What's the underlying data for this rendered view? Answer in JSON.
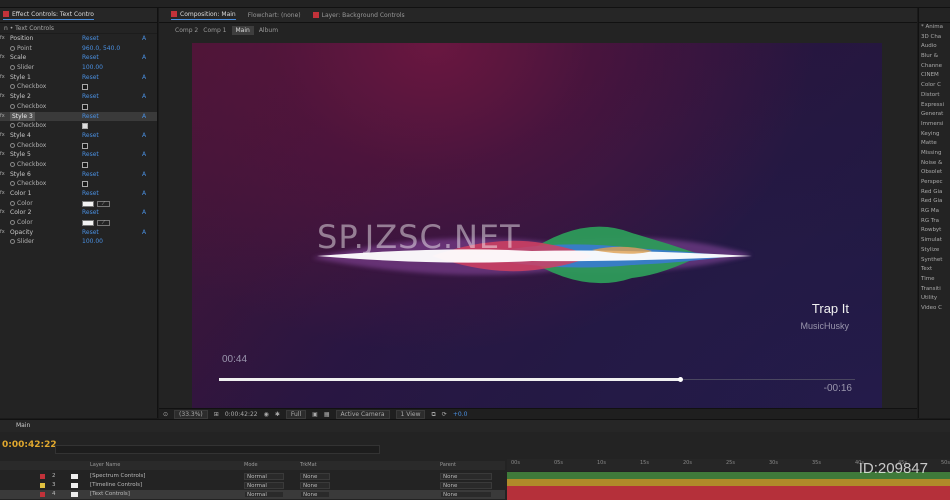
{
  "effect_controls": {
    "tab_label": "Effect Controls: Text Contro",
    "subtitle": "n • Text Controls",
    "rows": [
      {
        "name": "Position",
        "type": "header",
        "reset": "Reset",
        "about": "A"
      },
      {
        "name": "Point",
        "type": "point",
        "value": "960.0, 540.0"
      },
      {
        "name": "Scale",
        "type": "header",
        "reset": "Reset",
        "about": "A"
      },
      {
        "name": "Slider",
        "type": "slider",
        "value": "100.00"
      },
      {
        "name": "Style 1",
        "type": "header",
        "reset": "Reset",
        "about": "A"
      },
      {
        "name": "Checkbox",
        "type": "checkbox",
        "checked": false
      },
      {
        "name": "Style 2",
        "type": "header",
        "reset": "Reset",
        "about": "A"
      },
      {
        "name": "Checkbox",
        "type": "checkbox",
        "checked": false
      },
      {
        "name": "Style 3",
        "type": "header",
        "reset": "Reset",
        "about": "A",
        "selected": true
      },
      {
        "name": "Checkbox",
        "type": "checkbox",
        "checked": true
      },
      {
        "name": "Style 4",
        "type": "header",
        "reset": "Reset",
        "about": "A"
      },
      {
        "name": "Checkbox",
        "type": "checkbox",
        "checked": false
      },
      {
        "name": "Style 5",
        "type": "header",
        "reset": "Reset",
        "about": "A"
      },
      {
        "name": "Checkbox",
        "type": "checkbox",
        "checked": false
      },
      {
        "name": "Style 6",
        "type": "header",
        "reset": "Reset",
        "about": "A"
      },
      {
        "name": "Checkbox",
        "type": "checkbox",
        "checked": false
      },
      {
        "name": "Color 1",
        "type": "header",
        "reset": "Reset",
        "about": "A"
      },
      {
        "name": "Color",
        "type": "color"
      },
      {
        "name": "Color 2",
        "type": "header",
        "reset": "Reset",
        "about": "A"
      },
      {
        "name": "Color",
        "type": "color"
      },
      {
        "name": "Opacity",
        "type": "header",
        "reset": "Reset",
        "about": "A"
      },
      {
        "name": "Slider",
        "type": "slider",
        "value": "100.00"
      }
    ]
  },
  "composition": {
    "tab_label": "Composition: Main",
    "tab_flowchart": "Flowchart: (none)",
    "tab_layer": "Layer: Background Controls",
    "breadcrumbs": [
      "Comp 2",
      "Comp 1",
      "Main",
      "Album"
    ],
    "active_crumb": "Main",
    "song_title": "Trap It",
    "song_artist": "MusicHusky",
    "time_elapsed": "00:44",
    "time_remaining": "-00:16",
    "progress": 0.725,
    "watermark": "SP.JZSC.NET",
    "footer": {
      "zoom": "(33.3%)",
      "timecode": "0:00:42:22",
      "resolution": "Full",
      "camera": "Active Camera",
      "view": "1 View",
      "exposure": "+0.0"
    }
  },
  "effects_presets": {
    "items": [
      "* Anima",
      "3D Cha",
      "Audio",
      "Blur &",
      "Channe",
      "CINEM",
      "Color C",
      "Distort",
      "Expressi",
      "Generat",
      "Immersi",
      "Keying",
      "Matte",
      "Missing",
      "Noise &",
      "Obsolet",
      "Perspec",
      "Red Gia",
      "Red Gia",
      "RG Ma",
      "RG Tra",
      "Rowbyt",
      "Simulat",
      "Stylize",
      "Synthet",
      "Text",
      "Time",
      "Transiti",
      "Utility",
      "Video C"
    ]
  },
  "timeline": {
    "tab_label": "Main",
    "current_time": "0:00:42:22",
    "header": {
      "layer_name": "Layer Name",
      "mode": "Mode",
      "trkmat": "TrkMat",
      "parent": "Parent"
    },
    "layers": [
      {
        "num": "2",
        "name": "[Spectrum Controls]",
        "mode": "Normal",
        "trkmat": "None",
        "parent": "None",
        "color": "#c2323a"
      },
      {
        "num": "3",
        "name": "[Timeline Controls]",
        "mode": "Normal",
        "trkmat": "None",
        "parent": "None",
        "color": "#e0c040"
      },
      {
        "num": "4",
        "name": "[Text Controls]",
        "mode": "Normal",
        "trkmat": "None",
        "parent": "None",
        "color": "#c2323a",
        "selected": true
      }
    ],
    "ruler_ticks": [
      "00s",
      "05s",
      "10s",
      "15s",
      "20s",
      "25s",
      "30s",
      "35s",
      "40s",
      "45s",
      "50s"
    ],
    "track_colors": [
      "#3f7a3a",
      "#b08a2a",
      "#b5303a",
      "#b5303a"
    ],
    "id_watermark": "ID:209847"
  }
}
